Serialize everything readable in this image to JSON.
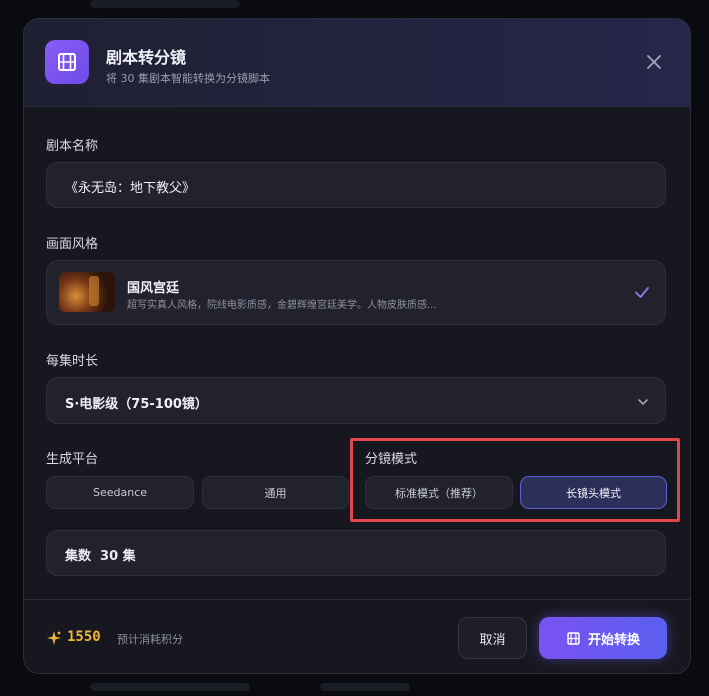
{
  "header": {
    "title": "剧本转分镜",
    "subtitle": "将 30 集剧本智能转换为分镜脚本"
  },
  "script_name": {
    "label": "剧本名称",
    "value": "《永无岛：地下教父》"
  },
  "visual_style": {
    "label": "画面风格",
    "name": "国风宫廷",
    "description": "超写实真人风格，院线电影质感，金碧辉煌宫廷美学。人物皮肤质感..."
  },
  "duration": {
    "label": "每集时长",
    "value": "S·电影级（75-100镜）"
  },
  "platform": {
    "label": "生成平台",
    "options": [
      "Seedance",
      "通用"
    ]
  },
  "storyboard_mode": {
    "label": "分镜模式",
    "options": [
      "标准模式（推荐）",
      "长镜头模式"
    ],
    "selected": "长镜头模式"
  },
  "episodes": {
    "text": "集数  30 集"
  },
  "footer": {
    "points": "1550",
    "points_label": "预计消耗积分",
    "cancel_label": "取消",
    "start_label": "开始转换"
  },
  "icons": {
    "header": "film-icon",
    "close": "close-icon",
    "check": "check-icon",
    "chevron": "chevron-down-icon",
    "coin": "sparkle-icon",
    "start": "film-icon"
  },
  "colors": {
    "accent": "#7a52f2",
    "highlight": "#e0474c",
    "points": "#f0b63a"
  }
}
